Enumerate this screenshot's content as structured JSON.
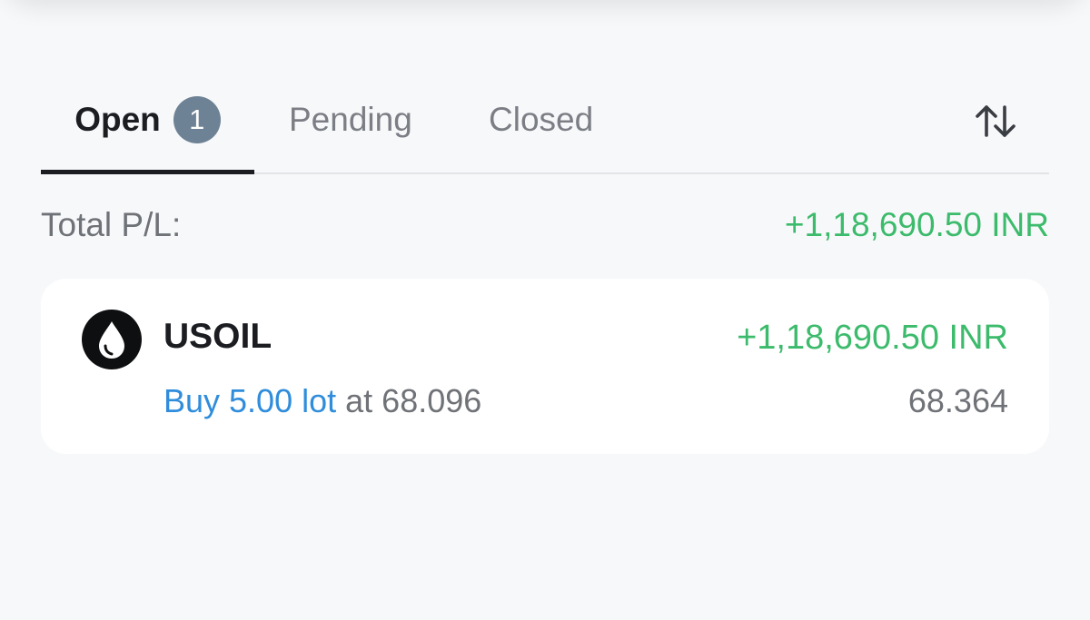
{
  "tabs": [
    {
      "label": "Open",
      "badge": "1",
      "active": true
    },
    {
      "label": "Pending"
    },
    {
      "label": "Closed"
    }
  ],
  "sort_icon": "sort-arrows-icon",
  "summary": {
    "total_label": "Total P/L:",
    "total_value": "+1,18,690.50 INR"
  },
  "positions": [
    {
      "icon": "oil-drop-icon",
      "symbol": "USOIL",
      "pnl": "+1,18,690.50 INR",
      "side_volume": "Buy 5.00 lot",
      "open_price_text": "at 68.096",
      "current_price": "68.364"
    }
  ],
  "colors": {
    "profit": "#3dbb6c",
    "buy": "#2f8ddc",
    "badge": "#6d8294",
    "active_tab": "#1b1d21"
  }
}
